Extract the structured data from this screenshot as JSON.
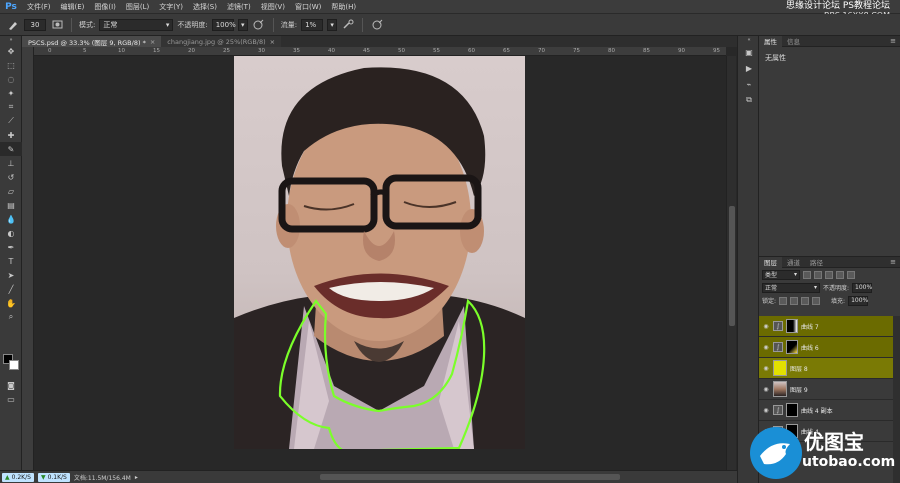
{
  "menubar": {
    "items": [
      "文件(F)",
      "编辑(E)",
      "图像(I)",
      "图层(L)",
      "文字(Y)",
      "选择(S)",
      "滤镜(T)",
      "视图(V)",
      "窗口(W)",
      "帮助(H)"
    ],
    "watermark_line1": "思缘设计论坛",
    "watermark_line2": "PS教程论坛",
    "watermark_line3": "BBS.16XX8.COM"
  },
  "options": {
    "brush_size": "30",
    "mode_label": "模式:",
    "mode_value": "正常",
    "opacity_label": "不透明度:",
    "opacity_value": "100%",
    "flow_label": "流量:",
    "flow_value": "1%"
  },
  "tabs": [
    {
      "label": "PSCS.psd @ 33.3% (图层 9, RGB/8) *"
    },
    {
      "label": "changjiang.jpg @ 25%(RGB/8)"
    }
  ],
  "ruler": {
    "ticks": [
      "0",
      "5",
      "10",
      "15",
      "20",
      "25",
      "30",
      "35",
      "40",
      "45",
      "50",
      "55",
      "60",
      "65",
      "70",
      "75",
      "80",
      "85",
      "90",
      "95"
    ]
  },
  "status": {
    "pill1": "0.2K/S",
    "pill2": "0.1K/S",
    "doc_info": "文档:11.5M/156.4M"
  },
  "properties": {
    "tab_properties": "属性",
    "tab_info": "信息",
    "no_properties": "无属性"
  },
  "layers": {
    "tab_layers": "图层",
    "tab_channels": "通道",
    "tab_paths": "路径",
    "kind_filter": "类型",
    "blend_mode": "正常",
    "opacity_label": "不透明度:",
    "opacity_value": "100%",
    "lock_label": "锁定:",
    "fill_label": "填充:",
    "fill_value": "100%",
    "rows": [
      {
        "name": "曲线 7"
      },
      {
        "name": "曲线 6"
      },
      {
        "name": "图层 8"
      },
      {
        "name": "图层 9"
      },
      {
        "name": "曲线 4 副本"
      },
      {
        "name": "曲线 4"
      }
    ]
  },
  "watermark_bottom": {
    "title": "优图宝",
    "url": "utobao.com"
  }
}
